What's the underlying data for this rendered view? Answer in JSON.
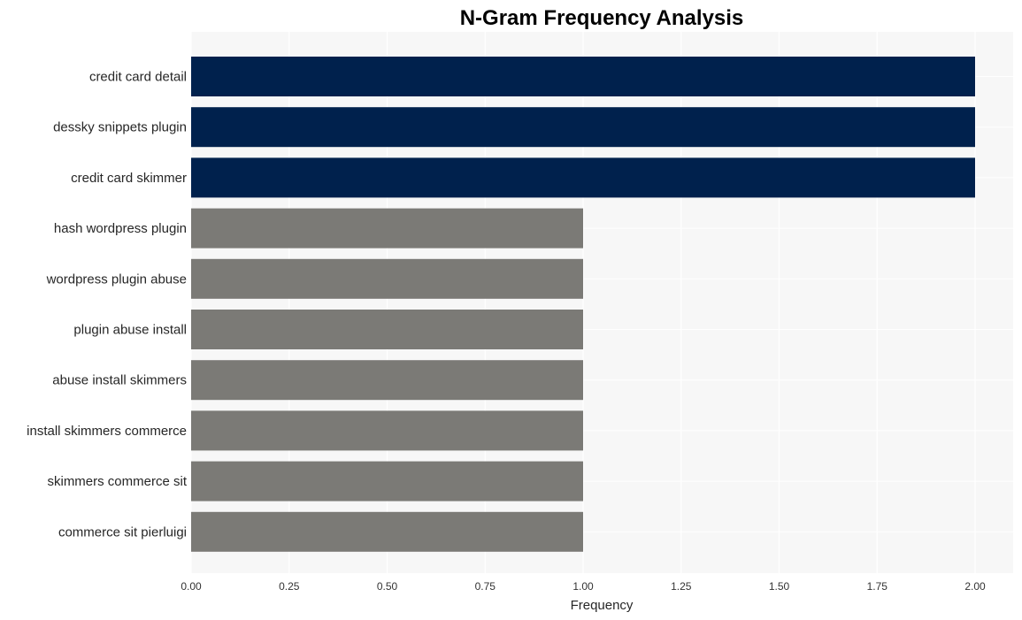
{
  "chart_data": {
    "type": "bar",
    "orientation": "horizontal",
    "title": "N-Gram Frequency Analysis",
    "xlabel": "Frequency",
    "ylabel": "",
    "categories": [
      "credit card detail",
      "dessky snippets plugin",
      "credit card skimmer",
      "hash wordpress plugin",
      "wordpress plugin abuse",
      "plugin abuse install",
      "abuse install skimmers",
      "install skimmers commerce",
      "skimmers commerce sit",
      "commerce sit pierluigi"
    ],
    "values": [
      2,
      2,
      2,
      1,
      1,
      1,
      1,
      1,
      1,
      1
    ],
    "xlim": [
      0,
      2.1
    ],
    "xticks": [
      0,
      0.25,
      0.5,
      0.75,
      1.0,
      1.25,
      1.5,
      1.75,
      2.0
    ],
    "xtick_labels": [
      "0.00",
      "0.25",
      "0.50",
      "0.75",
      "1.00",
      "1.25",
      "1.50",
      "1.75",
      "2.00"
    ],
    "grid": true,
    "legend": "none",
    "colors": {
      "highlight": "#00214d",
      "default": "#7b7a76",
      "plot_background": "#f7f7f7",
      "gridline": "#ffffff"
    }
  }
}
